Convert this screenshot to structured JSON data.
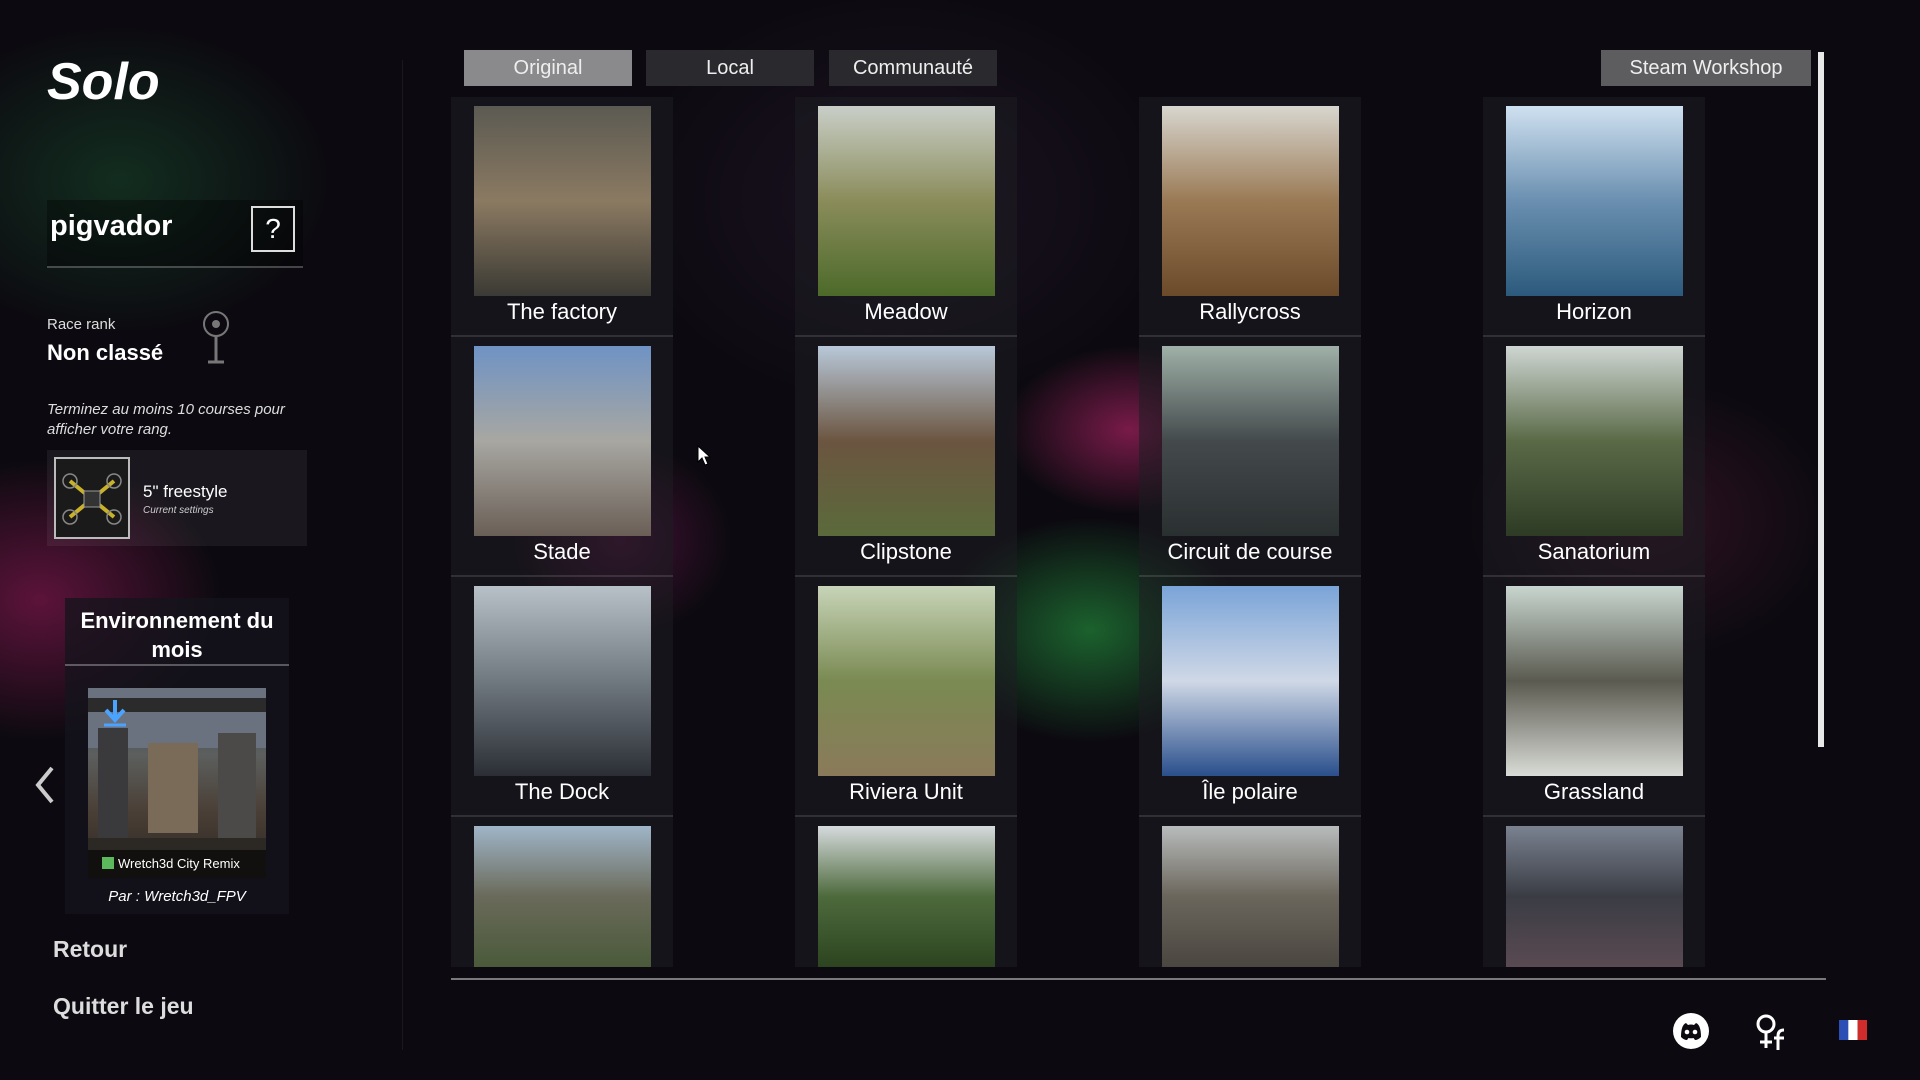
{
  "page_title": "Solo",
  "profile": {
    "username": "pigvador",
    "help_label": "?"
  },
  "rank": {
    "label": "Race rank",
    "value": "Non classé",
    "note": "Terminez au moins 10 courses pour afficher votre rang."
  },
  "drone": {
    "name": "5\" freestyle",
    "subtitle": "Current settings"
  },
  "environment_of_month": {
    "title": "Environnement du mois",
    "map_name": "Wretch3d City Remix",
    "author": "Par : Wretch3d_FPV"
  },
  "menu": {
    "back": "Retour",
    "quit": "Quitter le jeu"
  },
  "tabs": [
    {
      "label": "Original",
      "active": true
    },
    {
      "label": "Local",
      "active": false
    },
    {
      "label": "Communauté",
      "active": false
    }
  ],
  "workshop_label": "Steam Workshop",
  "maps": [
    {
      "label": "The factory",
      "colors": [
        "#5b5a52",
        "#8b7a62",
        "#3b3a34"
      ]
    },
    {
      "label": "Meadow",
      "colors": [
        "#c9cfc8",
        "#8a8c5a",
        "#4c6a2a"
      ]
    },
    {
      "label": "Rallycross",
      "colors": [
        "#d8d6cf",
        "#9a7a55",
        "#6b4a2a"
      ]
    },
    {
      "label": "Horizon",
      "colors": [
        "#cfe1f0",
        "#6a8fb0",
        "#2c5a7c"
      ]
    },
    {
      "label": "Stade",
      "colors": [
        "#6f93c4",
        "#a8a7a2",
        "#6a5f56"
      ]
    },
    {
      "label": "Clipstone",
      "colors": [
        "#b8c8d9",
        "#6b5540",
        "#5b6a3b"
      ]
    },
    {
      "label": "Circuit de course",
      "colors": [
        "#9fb1a8",
        "#444a4c",
        "#2a2f30"
      ]
    },
    {
      "label": "Sanatorium",
      "colors": [
        "#cfd6d3",
        "#5a6a47",
        "#2e3b25"
      ]
    },
    {
      "label": "The Dock",
      "colors": [
        "#b8c0c8",
        "#707880",
        "#2b2f35"
      ]
    },
    {
      "label": "Riviera Unit",
      "colors": [
        "#c8d4b8",
        "#7a8a52",
        "#8a7a5a"
      ]
    },
    {
      "label": "Île polaire",
      "colors": [
        "#7aa4d8",
        "#cfd8e6",
        "#2a4f8c"
      ]
    },
    {
      "label": "Grassland",
      "colors": [
        "#c8d6cf",
        "#5a5a50",
        "#d9dbd6"
      ]
    },
    {
      "label": "",
      "colors": [
        "#9fb5c8",
        "#6a6a5a",
        "#4a5a3a"
      ]
    },
    {
      "label": "",
      "colors": [
        "#d6dadd",
        "#4d6a3c",
        "#2c4420"
      ]
    },
    {
      "label": "",
      "colors": [
        "#b8bcbc",
        "#6b665c",
        "#4a4640"
      ]
    },
    {
      "label": "",
      "colors": [
        "#7a8290",
        "#3a3c44",
        "#5a4a52"
      ]
    }
  ],
  "language": "FR"
}
